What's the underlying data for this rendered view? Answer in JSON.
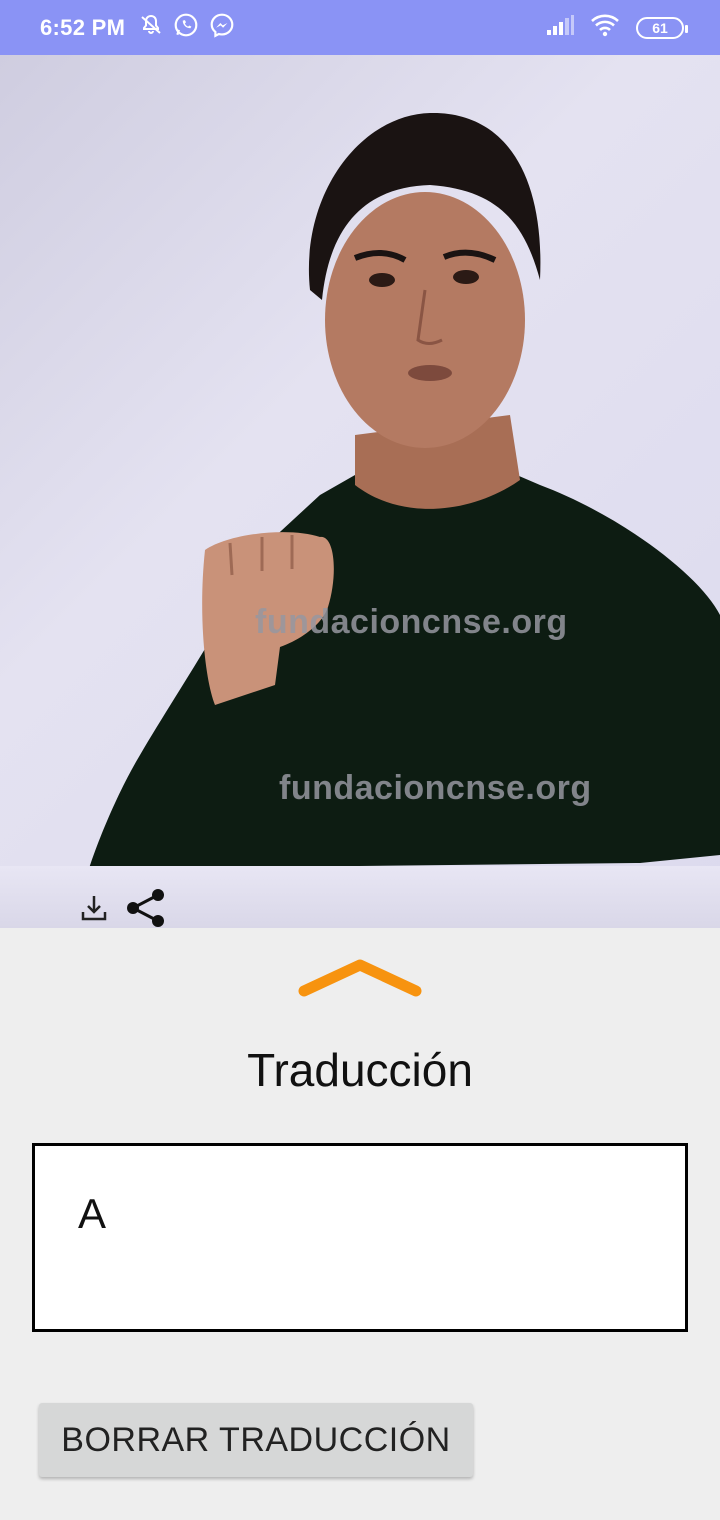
{
  "status_bar": {
    "time": "6:52 PM",
    "battery": "61",
    "icons": [
      "notifications-off-icon",
      "whatsapp-icon",
      "messenger-icon",
      "signal-icon",
      "wifi-icon",
      "battery-icon"
    ]
  },
  "camera": {
    "watermark_1": "fundacioncnse.org",
    "watermark_2": "fundacioncnse.org",
    "toolbar_icons": [
      "download-icon",
      "share-icon"
    ]
  },
  "panel": {
    "chevron_color": "#f7930f",
    "title": "Traducción",
    "output_value": "A",
    "clear_button_label": "BORRAR TRADUCCIÓN"
  },
  "colors": {
    "status_bar": "#8a93f5",
    "panel_background": "#eeeeee",
    "button_background": "#d6d7d7"
  }
}
